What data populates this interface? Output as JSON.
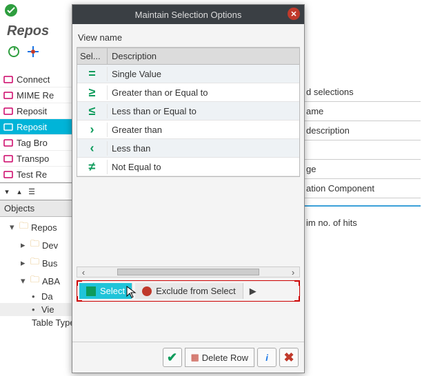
{
  "toolbar_top": {},
  "repos_title": "Repos",
  "left_tree": [
    {
      "icon": "connector",
      "label": "Connect"
    },
    {
      "icon": "mime",
      "label": "MIME Re"
    },
    {
      "icon": "repo",
      "label": "Reposit"
    },
    {
      "icon": "repo-sel",
      "label": "Reposit",
      "selected": true
    },
    {
      "icon": "tag",
      "label": "Tag Bro"
    },
    {
      "icon": "truck",
      "label": "Transpo"
    },
    {
      "icon": "test",
      "label": "Test Re"
    }
  ],
  "objects_label": "Objects",
  "obj_tree": [
    {
      "level": 1,
      "open": true,
      "folder": true,
      "label": "Repos"
    },
    {
      "level": 2,
      "open": false,
      "folder": true,
      "label": "Dev"
    },
    {
      "level": 2,
      "open": false,
      "folder": true,
      "label": "Bus"
    },
    {
      "level": 2,
      "open": true,
      "folder": true,
      "label": "ABA"
    },
    {
      "level": 3,
      "bullet": true,
      "label": "Da"
    },
    {
      "level": 3,
      "bullet": true,
      "label": "Vie",
      "sel": true
    },
    {
      "level": 3,
      "plain": true,
      "label": "Table Types"
    }
  ],
  "right_rows": [
    "d selections",
    "ame",
    "description",
    "",
    "ge",
    "ation Component"
  ],
  "right_footer": "im no. of hits",
  "dialog": {
    "title": "Maintain Selection Options",
    "view_name_label": "View name",
    "head_col1": "Sel...",
    "head_col2": "Description",
    "rows": [
      {
        "glyph": "=",
        "label": "Single Value"
      },
      {
        "glyph": "≥",
        "label": "Greater than or Equal to"
      },
      {
        "glyph": "≤",
        "label": "Less than or Equal to"
      },
      {
        "glyph": "›",
        "label": "Greater than"
      },
      {
        "glyph": "‹",
        "label": "Less than"
      },
      {
        "glyph": "≠",
        "label": "Not Equal to"
      }
    ],
    "tab_select": "Select",
    "tab_exclude": "Exclude from Select",
    "footer": {
      "delete_row": "Delete Row"
    }
  }
}
